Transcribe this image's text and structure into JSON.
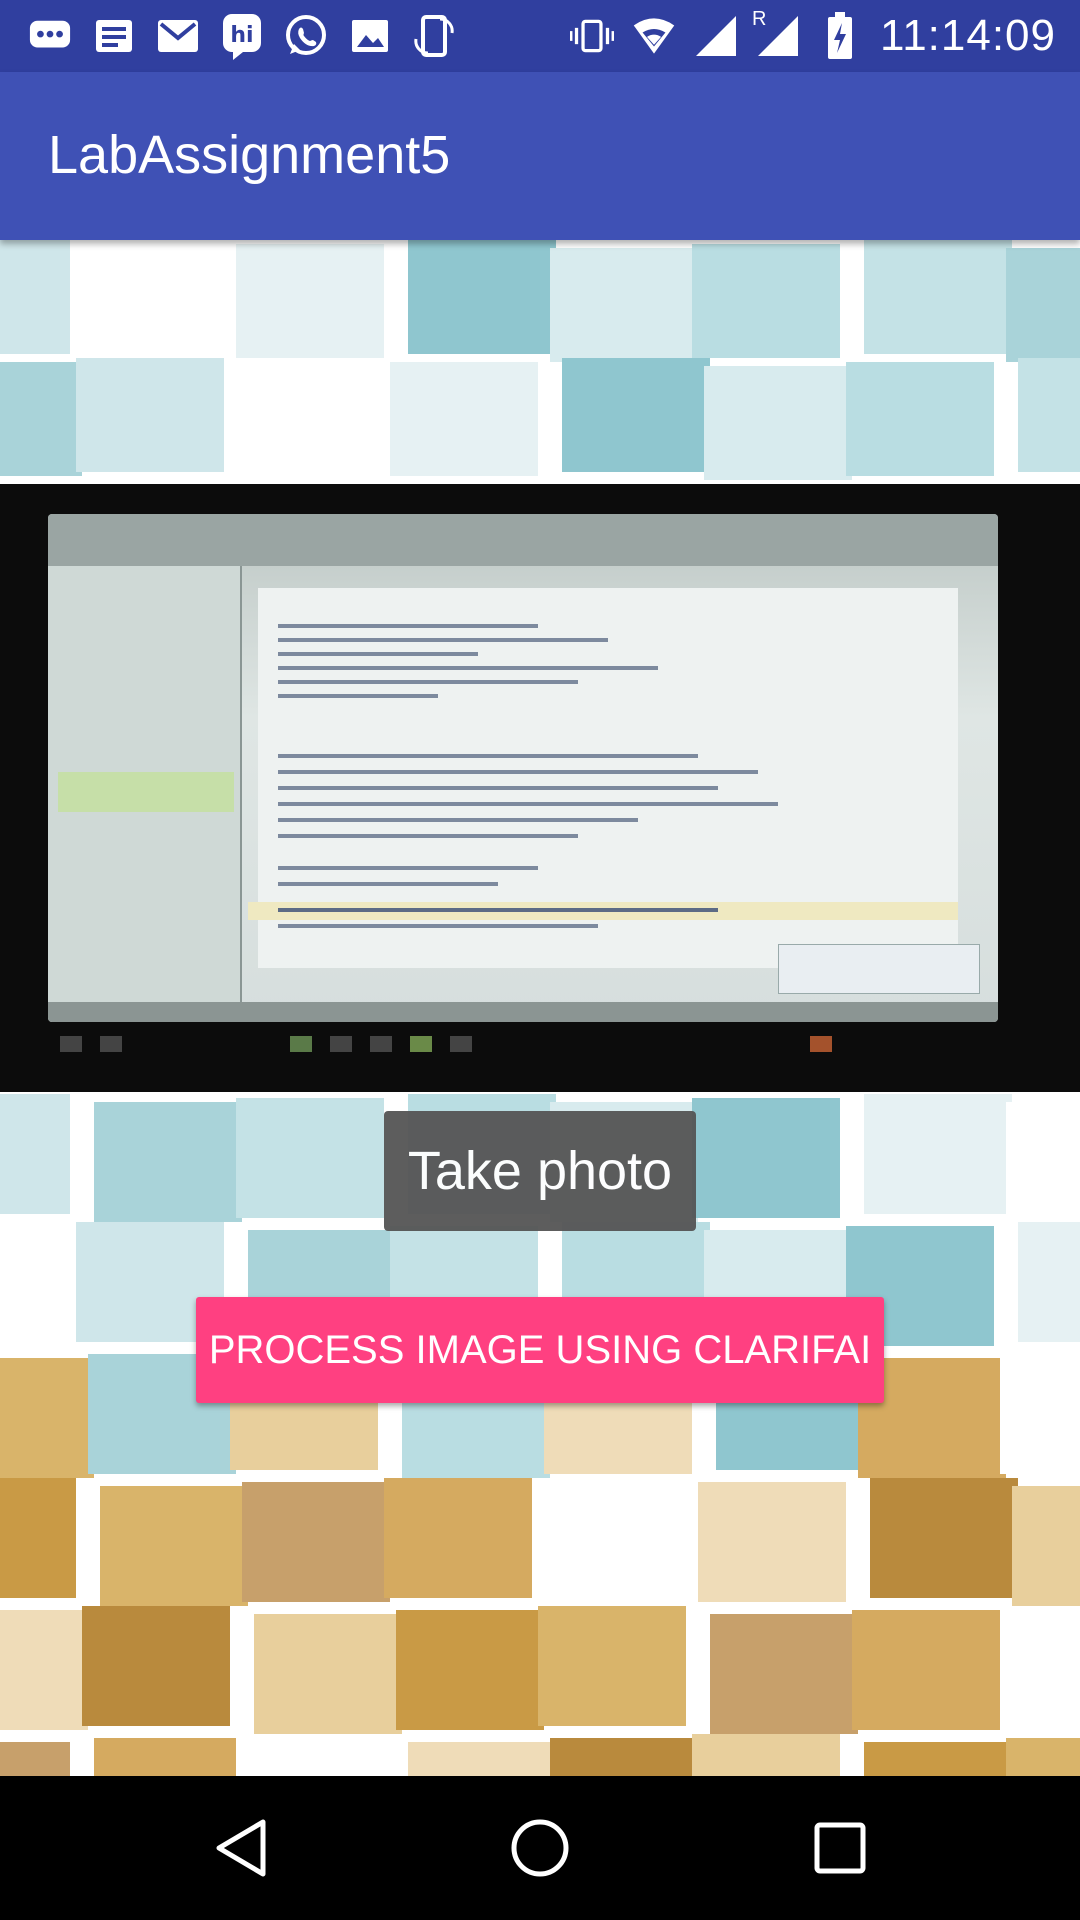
{
  "status_bar": {
    "time": "11:14:09",
    "left_icons": [
      "chat-bubble-icon",
      "note-icon",
      "gmail-icon",
      "hike-icon",
      "whatsapp-icon",
      "image-icon",
      "screen-rotate-icon"
    ],
    "right_icons": [
      "vibrate-icon",
      "wifi-icon",
      "signal-icon",
      "roaming-signal-icon",
      "battery-charging-icon"
    ],
    "roaming_label": "R"
  },
  "app_bar": {
    "title": "LabAssignment5",
    "color": "#3F51B5",
    "status_color": "#303F9F"
  },
  "photo": {
    "description_icon": "captured-photo"
  },
  "toast": {
    "text": "Take photo"
  },
  "process_button": {
    "label": "PROCESS IMAGE USING CLARIFAI",
    "color": "#FF4081"
  },
  "nav_bar": {
    "icons": [
      "back-icon",
      "home-icon",
      "recents-icon"
    ]
  }
}
